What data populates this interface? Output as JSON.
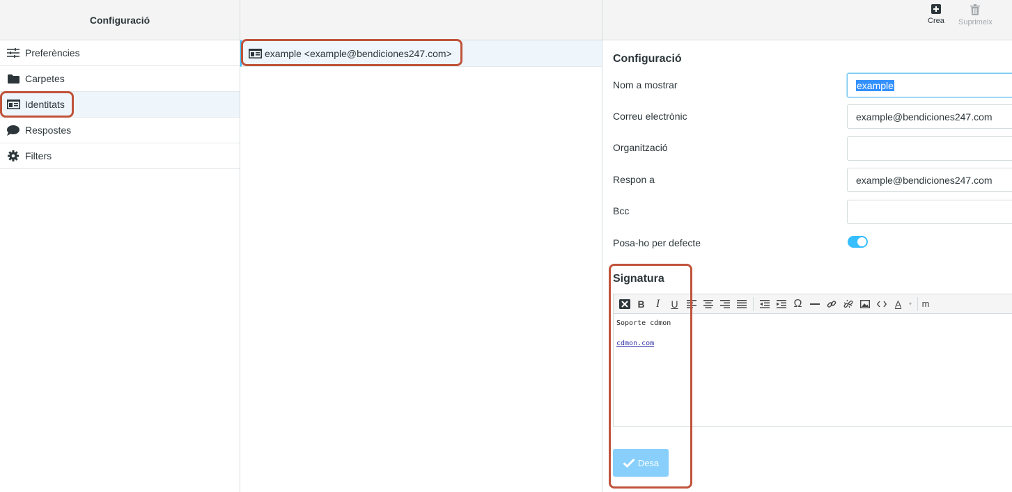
{
  "sidebar": {
    "title": "Configuració",
    "items": [
      {
        "label": "Preferències",
        "icon": "sliders-icon"
      },
      {
        "label": "Carpetes",
        "icon": "folder-icon"
      },
      {
        "label": "Identitats",
        "icon": "id-card-icon",
        "selected": true
      },
      {
        "label": "Respostes",
        "icon": "comment-icon"
      },
      {
        "label": "Filters",
        "icon": "gear-icon"
      }
    ]
  },
  "identities": {
    "items": [
      {
        "label": "example <example@bendiciones247.com>",
        "icon": "id-card-icon"
      }
    ]
  },
  "toolbar": {
    "create_label": "Crea",
    "delete_label": "Suprimeix"
  },
  "form": {
    "section_title": "Configuració",
    "display_name": {
      "label": "Nom a mostrar",
      "value": "example"
    },
    "email": {
      "label": "Correu electrònic",
      "value": "example@bendiciones247.com"
    },
    "organization": {
      "label": "Organització",
      "value": ""
    },
    "reply_to": {
      "label": "Respon a",
      "value": "example@bendiciones247.com"
    },
    "bcc": {
      "label": "Bcc",
      "value": ""
    },
    "default": {
      "label": "Posa-ho per defecte",
      "value": true
    }
  },
  "signature": {
    "title": "Signatura",
    "line1": "Soporte cdmon",
    "link": "cdmon.com",
    "toolbar_more": "m"
  },
  "save_label": "Desa",
  "colors": {
    "accent": "#37beff",
    "selected_bg": "#eff6fb",
    "annotation": "#c0533a",
    "save_button": "#88cffb"
  }
}
